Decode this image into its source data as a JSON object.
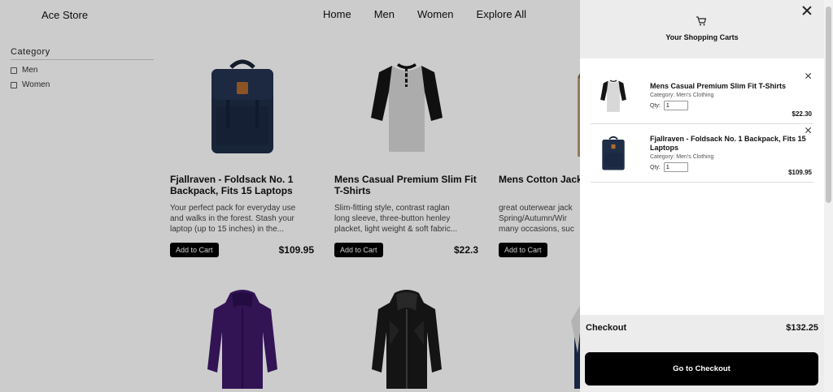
{
  "header": {
    "brand": "Ace Store",
    "nav": [
      "Home",
      "Men",
      "Women",
      "Explore All"
    ]
  },
  "sidebar": {
    "title": "Category",
    "options": [
      "Men",
      "Women"
    ]
  },
  "products": [
    {
      "title": "Fjallraven - Foldsack No. 1 Backpack, Fits 15 Laptops",
      "title_lines": [
        "Fjallraven - Foldsack No. 1",
        "Backpack, Fits 15 Laptops"
      ],
      "desc_lines": [
        "Your perfect pack for everyday use",
        "and walks in the forest. Stash your",
        "laptop (up to 15 inches) in the..."
      ],
      "price": "$109.95",
      "button": "Add to Cart",
      "image": "backpack-icon"
    },
    {
      "title": "Mens Casual Premium Slim Fit T-Shirts",
      "title_lines": [
        "Mens Casual Premium Slim Fit",
        "T-Shirts"
      ],
      "desc_lines": [
        "Slim-fitting style, contrast raglan",
        "long sleeve, three-button henley",
        "placket, light weight & soft fabric..."
      ],
      "price": "$22.3",
      "button": "Add to Cart",
      "image": "shirt-icon"
    },
    {
      "title": "Mens Cotton Jacket",
      "title_lines": [
        "Mens Cotton Jack",
        ""
      ],
      "desc_lines": [
        "great outerwear jack",
        "Spring/Autumn/Wir",
        "many occasions, suc"
      ],
      "price": "",
      "button": "Add to Cart",
      "image": "jacket-icon"
    }
  ],
  "cart": {
    "title": "Your Shopping Carts",
    "items": [
      {
        "title_lines": [
          "Mens Casual Premium Slim Fit T-Shirts"
        ],
        "category": "Category: Men's Clothing",
        "qty_label": "Qty:",
        "qty": "1",
        "price": "$22.30"
      },
      {
        "title_lines": [
          "Fjallraven - Foldsack No. 1 Backpack, Fits 15",
          "Laptops"
        ],
        "category": "Category: Men's Clothing",
        "qty_label": "Qty:",
        "qty": "1",
        "price": "$109.95"
      }
    ],
    "checkout_label": "Checkout",
    "total": "$132.25",
    "checkout_button": "Go to Checkout"
  },
  "colors": {
    "overlay": "#000000",
    "drawer_header": "#ececec",
    "button": "#000000"
  }
}
